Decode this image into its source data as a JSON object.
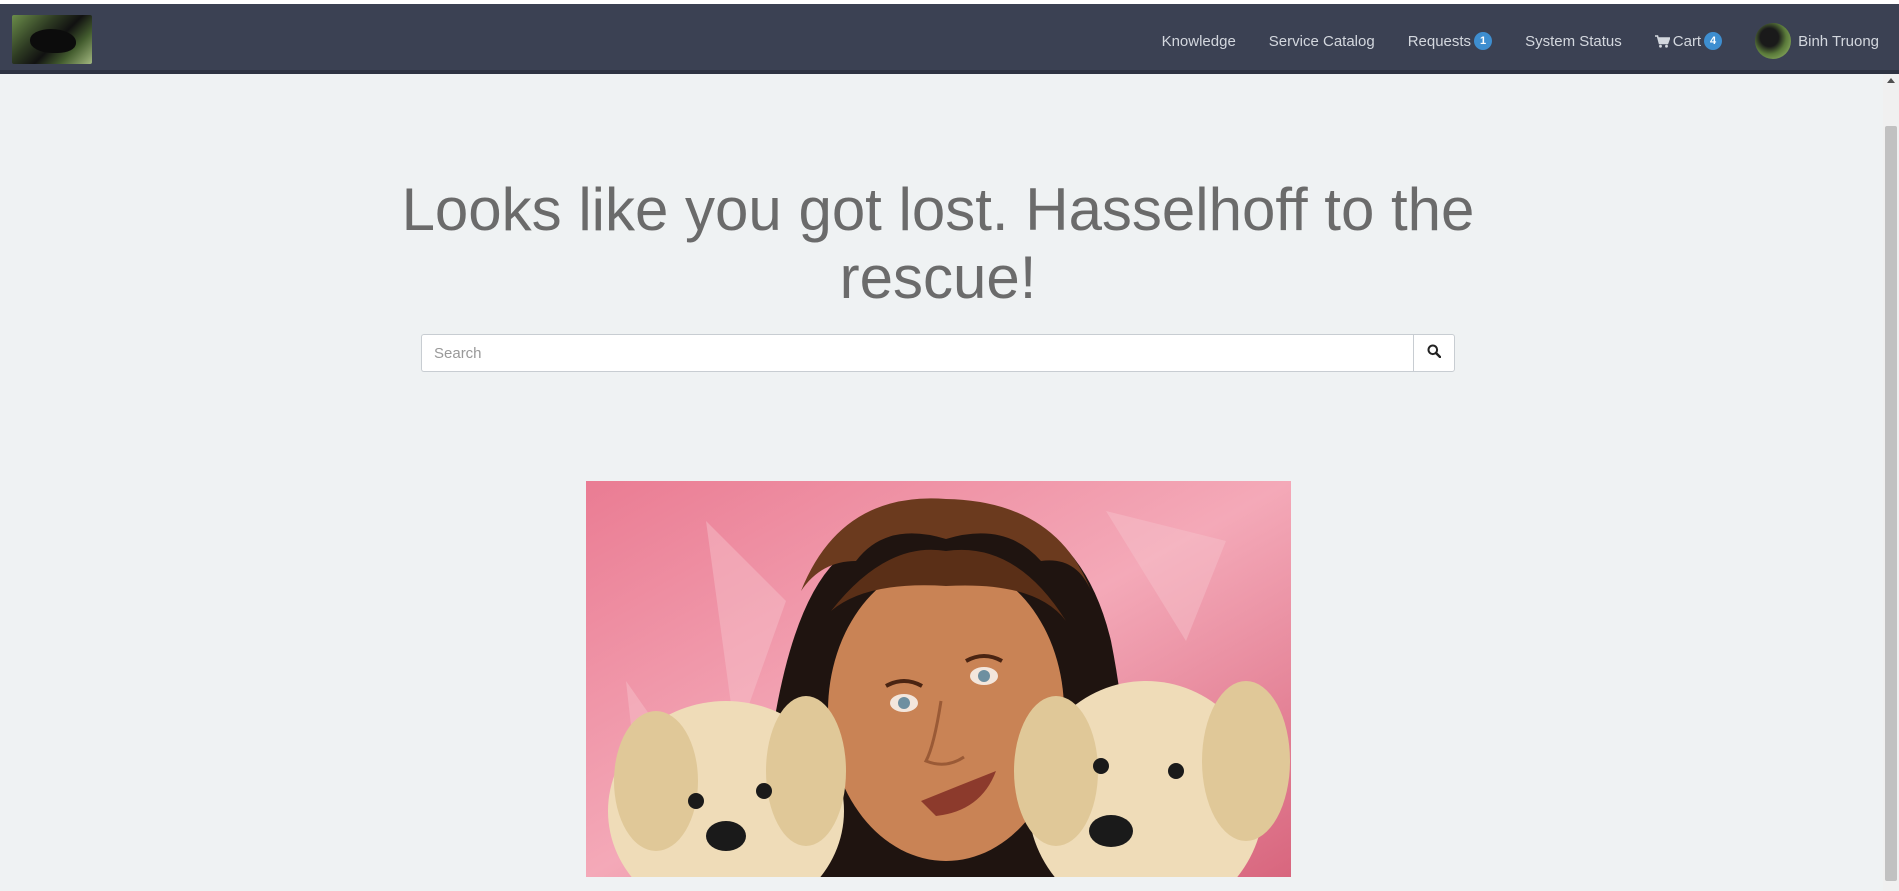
{
  "navbar": {
    "logo_icon": "panda-logo-icon",
    "items": [
      {
        "label": "Knowledge"
      },
      {
        "label": "Service Catalog"
      },
      {
        "label": "Requests",
        "badge": "1"
      },
      {
        "label": "System Status"
      },
      {
        "label": "Cart",
        "badge": "4",
        "icon": "shopping-cart-icon"
      }
    ],
    "user": {
      "name": "Binh Truong",
      "avatar_icon": "user-avatar"
    },
    "badge_color": "#3e8ed0",
    "background": "#3b4153"
  },
  "main": {
    "heading": "Looks like you got lost. Hasselhoff to the rescue!",
    "search": {
      "placeholder": "Search",
      "value": "",
      "button_icon": "search-icon"
    },
    "image": {
      "subject": "man-with-puppies-photo"
    }
  },
  "colors": {
    "page_background": "#eff2f3",
    "heading_text": "#6b6b6b"
  }
}
